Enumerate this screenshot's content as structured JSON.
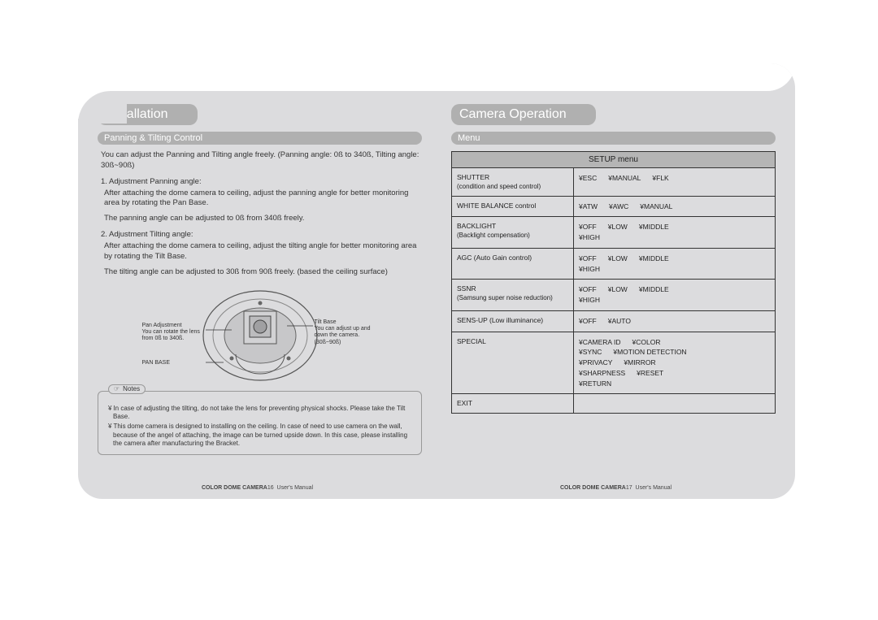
{
  "left": {
    "section_title": "Installation",
    "sub_heading": "Panning & Tilting Control",
    "intro": "You can adjust the Panning and Tilting angle freely. (Panning angle: 0ß to 340ß, Tilting angle: 30ß~90ß)",
    "item1_title": "1. Adjustment Panning angle:",
    "item1_p1": "After attaching the dome camera to ceiling, adjust the panning angle for better monitoring area by rotating the Pan Base.",
    "item1_p2": "The panning angle can be adjusted to 0ß from 340ß freely.",
    "item2_title": "2. Adjustment Tilting angle:",
    "item2_p1": "After attaching the dome camera to ceiling, adjust the tilting angle for better monitoring area by rotating the Tilt Base.",
    "item2_p2": "The tilting angle can be adjusted to 30ß from 90ß freely. (based the ceiling surface)",
    "diagram": {
      "pan_adj_title": "Pan Adjustment",
      "pan_adj_desc": "You can rotate the lens from 0ß to 340ß.",
      "pan_base": "PAN BASE",
      "tilt_base_title": "Tilt Base",
      "tilt_base_desc": "You can adjust up and down the camera. (30ß~90ß)"
    },
    "notes_label": "Notes",
    "notes": [
      "In case of adjusting the tilting, do not take the lens for preventing physical shocks. Please take the Tilt Base.",
      "This dome camera is designed to installing on the ceiling. In case of need to use camera on the wall, because of the angel of attaching, the image can be turned upside down. In this case, please installing the camera after manufacturing the Bracket."
    ],
    "footer_bold": "COLOR DOME CAMERA",
    "footer_page": "16",
    "footer_rest": "User's Manual"
  },
  "right": {
    "section_title": "Camera Operation",
    "sub_heading": "Menu",
    "menu_title": "SETUP menu",
    "rows": [
      {
        "label": "SHUTTER",
        "sub": "(condition and speed control)",
        "opts": [
          "ESC",
          "MANUAL",
          "FLK"
        ]
      },
      {
        "label": "WHITE BALANCE control",
        "sub": "",
        "opts": [
          "ATW",
          "AWC",
          "MANUAL"
        ]
      },
      {
        "label": "BACKLIGHT",
        "sub": "(Backlight compensation)",
        "opts": [
          "OFF",
          "LOW",
          "MIDDLE",
          "HIGH"
        ]
      },
      {
        "label": "AGC (Auto Gain control)",
        "sub": "",
        "opts": [
          "OFF",
          "LOW",
          "MIDDLE",
          "HIGH"
        ]
      },
      {
        "label": "SSNR",
        "sub": "(Samsung super noise reduction)",
        "opts": [
          "OFF",
          "LOW",
          "MIDDLE",
          "HIGH"
        ]
      },
      {
        "label": "SENS-UP (Low illuminance)",
        "sub": "",
        "opts": [
          "OFF",
          "AUTO"
        ]
      },
      {
        "label": "SPECIAL",
        "sub": "",
        "opts": [
          "CAMERA ID",
          "COLOR",
          "SYNC",
          "MOTION DETECTION",
          "PRIVACY",
          "MIRROR",
          "SHARPNESS",
          "RESET",
          "RETURN"
        ]
      },
      {
        "label": "EXIT",
        "sub": "",
        "opts": []
      }
    ],
    "footer_bold": "COLOR DOME CAMERA",
    "footer_page": "17",
    "footer_rest": "User's Manual"
  }
}
